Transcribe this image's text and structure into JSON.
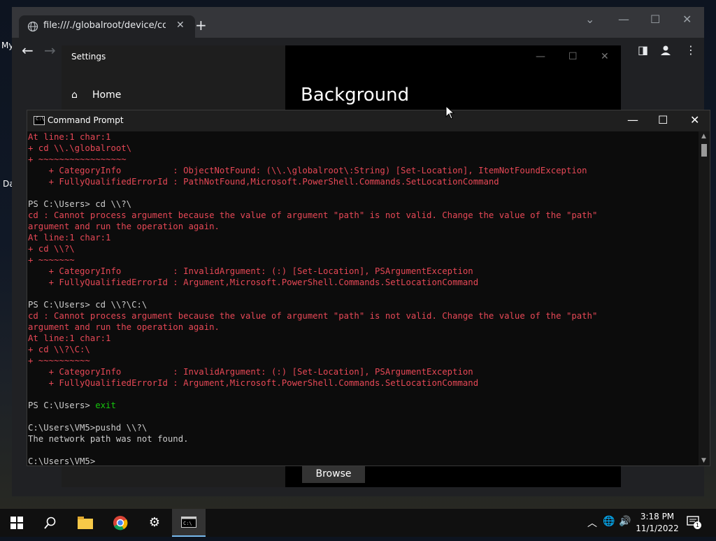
{
  "desktop": {
    "label_my": "My",
    "label_da": "Da"
  },
  "browser": {
    "tab_title": "file:///./globalroot/device/condrv/",
    "tab_close": "✕",
    "new_tab": "+",
    "back": "←",
    "forward": "→"
  },
  "settings": {
    "title": "Settings",
    "home_label": "Home",
    "heading": "Background",
    "browse_label": "Browse"
  },
  "cmd": {
    "title": "Command Prompt",
    "lines": [
      {
        "t": "At line:1 char:1",
        "c": "red"
      },
      {
        "t": "+ cd \\\\.\\globalroot\\",
        "c": "red"
      },
      {
        "t": "+ ~~~~~~~~~~~~~~~~~",
        "c": "red"
      },
      {
        "t": "    + CategoryInfo          : ObjectNotFound: (\\\\.\\globalroot\\:String) [Set-Location], ItemNotFoundException",
        "c": "red"
      },
      {
        "t": "    + FullyQualifiedErrorId : PathNotFound,Microsoft.PowerShell.Commands.SetLocationCommand",
        "c": "red"
      },
      {
        "t": "",
        "c": "wht"
      },
      {
        "t": "PS C:\\Users> cd \\\\?\\",
        "c": "wht"
      },
      {
        "t": "cd : Cannot process argument because the value of argument \"path\" is not valid. Change the value of the \"path\"",
        "c": "red"
      },
      {
        "t": "argument and run the operation again.",
        "c": "red"
      },
      {
        "t": "At line:1 char:1",
        "c": "red"
      },
      {
        "t": "+ cd \\\\?\\",
        "c": "red"
      },
      {
        "t": "+ ~~~~~~~",
        "c": "red"
      },
      {
        "t": "    + CategoryInfo          : InvalidArgument: (:) [Set-Location], PSArgumentException",
        "c": "red"
      },
      {
        "t": "    + FullyQualifiedErrorId : Argument,Microsoft.PowerShell.Commands.SetLocationCommand",
        "c": "red"
      },
      {
        "t": "",
        "c": "wht"
      },
      {
        "t": "PS C:\\Users> cd \\\\?\\C:\\",
        "c": "wht"
      },
      {
        "t": "cd : Cannot process argument because the value of argument \"path\" is not valid. Change the value of the \"path\"",
        "c": "red"
      },
      {
        "t": "argument and run the operation again.",
        "c": "red"
      },
      {
        "t": "At line:1 char:1",
        "c": "red"
      },
      {
        "t": "+ cd \\\\?\\C:\\",
        "c": "red"
      },
      {
        "t": "+ ~~~~~~~~~~",
        "c": "red"
      },
      {
        "t": "    + CategoryInfo          : InvalidArgument: (:) [Set-Location], PSArgumentException",
        "c": "red"
      },
      {
        "t": "    + FullyQualifiedErrorId : Argument,Microsoft.PowerShell.Commands.SetLocationCommand",
        "c": "red"
      },
      {
        "t": "",
        "c": "wht"
      },
      {
        "t": "PS C:\\Users> ",
        "c": "wht",
        "cmd": "exit"
      },
      {
        "t": "",
        "c": "wht"
      },
      {
        "t": "C:\\Users\\VM5>pushd \\\\?\\",
        "c": "wht"
      },
      {
        "t": "The network path was not found.",
        "c": "wht"
      },
      {
        "t": "",
        "c": "wht"
      },
      {
        "t": "C:\\Users\\VM5>",
        "c": "wht"
      }
    ]
  },
  "taskbar": {
    "time": "3:18 PM",
    "date": "11/1/2022",
    "notification_count": "1"
  },
  "colors": {
    "console_error": "#e74856",
    "console_text": "#cccccc",
    "console_command": "#16c60c"
  }
}
